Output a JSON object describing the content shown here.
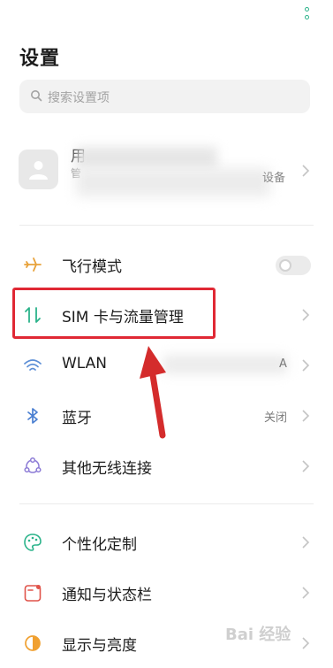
{
  "header": {
    "title": "设置"
  },
  "search": {
    "placeholder": "搜索设置项"
  },
  "account": {
    "name_fragment": "用",
    "sub_fragment": "管",
    "tail": "设备"
  },
  "rows": [
    {
      "label": "飞行模式",
      "icon": "airplane-icon",
      "control": "toggle-off"
    },
    {
      "label": "SIM 卡与流量管理",
      "icon": "sim-data-icon"
    },
    {
      "label": "WLAN",
      "icon": "wifi-icon",
      "value_tail": "A"
    },
    {
      "label": "蓝牙",
      "icon": "bluetooth-icon",
      "value": "关闭"
    },
    {
      "label": "其他无线连接",
      "icon": "connections-icon"
    },
    {
      "label": "个性化定制",
      "icon": "palette-icon"
    },
    {
      "label": "通知与状态栏",
      "icon": "notification-icon"
    },
    {
      "label": "显示与亮度",
      "icon": "brightness-icon"
    }
  ],
  "watermark": "Bai 经验",
  "colors": {
    "accent": "#2bb38a",
    "highlight": "#e02834",
    "text": "#1c1c1c",
    "secondary": "#7a7a7a"
  }
}
